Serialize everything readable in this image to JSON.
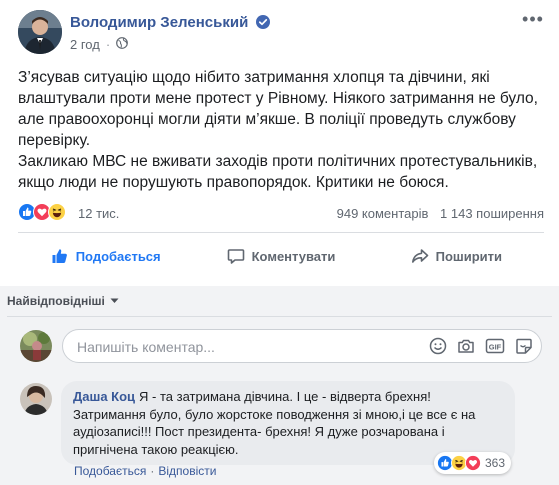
{
  "post": {
    "author": "Володимир Зеленський",
    "time": "2 год",
    "paragraphs": [
      "З’ясував ситуацію щодо нібито затримання хлопця та дівчини, які влаштували проти мене протест у Рівному. Ніякого затримання не було, але правоохоронці могли діяти м’якше. В поліції проведуть службову перевірку.",
      "Закликаю МВС не вживати заходів проти політичних протестувальників, якщо люди не порушують правопорядок. Критики не боюся."
    ]
  },
  "summary": {
    "reactions_count": "12 тис.",
    "comments": "949 коментарів",
    "shares": "1 143 поширення"
  },
  "actions": {
    "like": "Подобається",
    "comment": "Коментувати",
    "share": "Поширити"
  },
  "comments": {
    "sort_label": "Найвідповідніші",
    "compose_placeholder": "Напишіть коментар...",
    "items": [
      {
        "author": "Даша Коц",
        "text": "Я - та затримана дівчина. І це - відверта брехня! Затримання було, було жорстоке поводження зі мною,і це все є на аудіозаписі!!! Пост президента- брехня! Я дуже розчарована і пригнічена такою реакцією.",
        "like_label": "Подобається",
        "reply_label": "Відповісти",
        "reactions_count": "363"
      }
    ]
  },
  "colors": {
    "link": "#385898",
    "accent": "#2078f4",
    "muted": "#606770",
    "comments_bg": "#f2f3f5",
    "bubble_bg": "#e9ebee"
  },
  "icons": [
    "verified-badge-icon",
    "globe-icon",
    "more-options-icon",
    "like-reaction-icon",
    "love-reaction-icon",
    "haha-reaction-icon",
    "thumbs-up-icon",
    "comment-icon",
    "share-icon",
    "chevron-down-icon",
    "emoji-icon",
    "camera-icon",
    "gif-icon",
    "sticker-icon"
  ]
}
